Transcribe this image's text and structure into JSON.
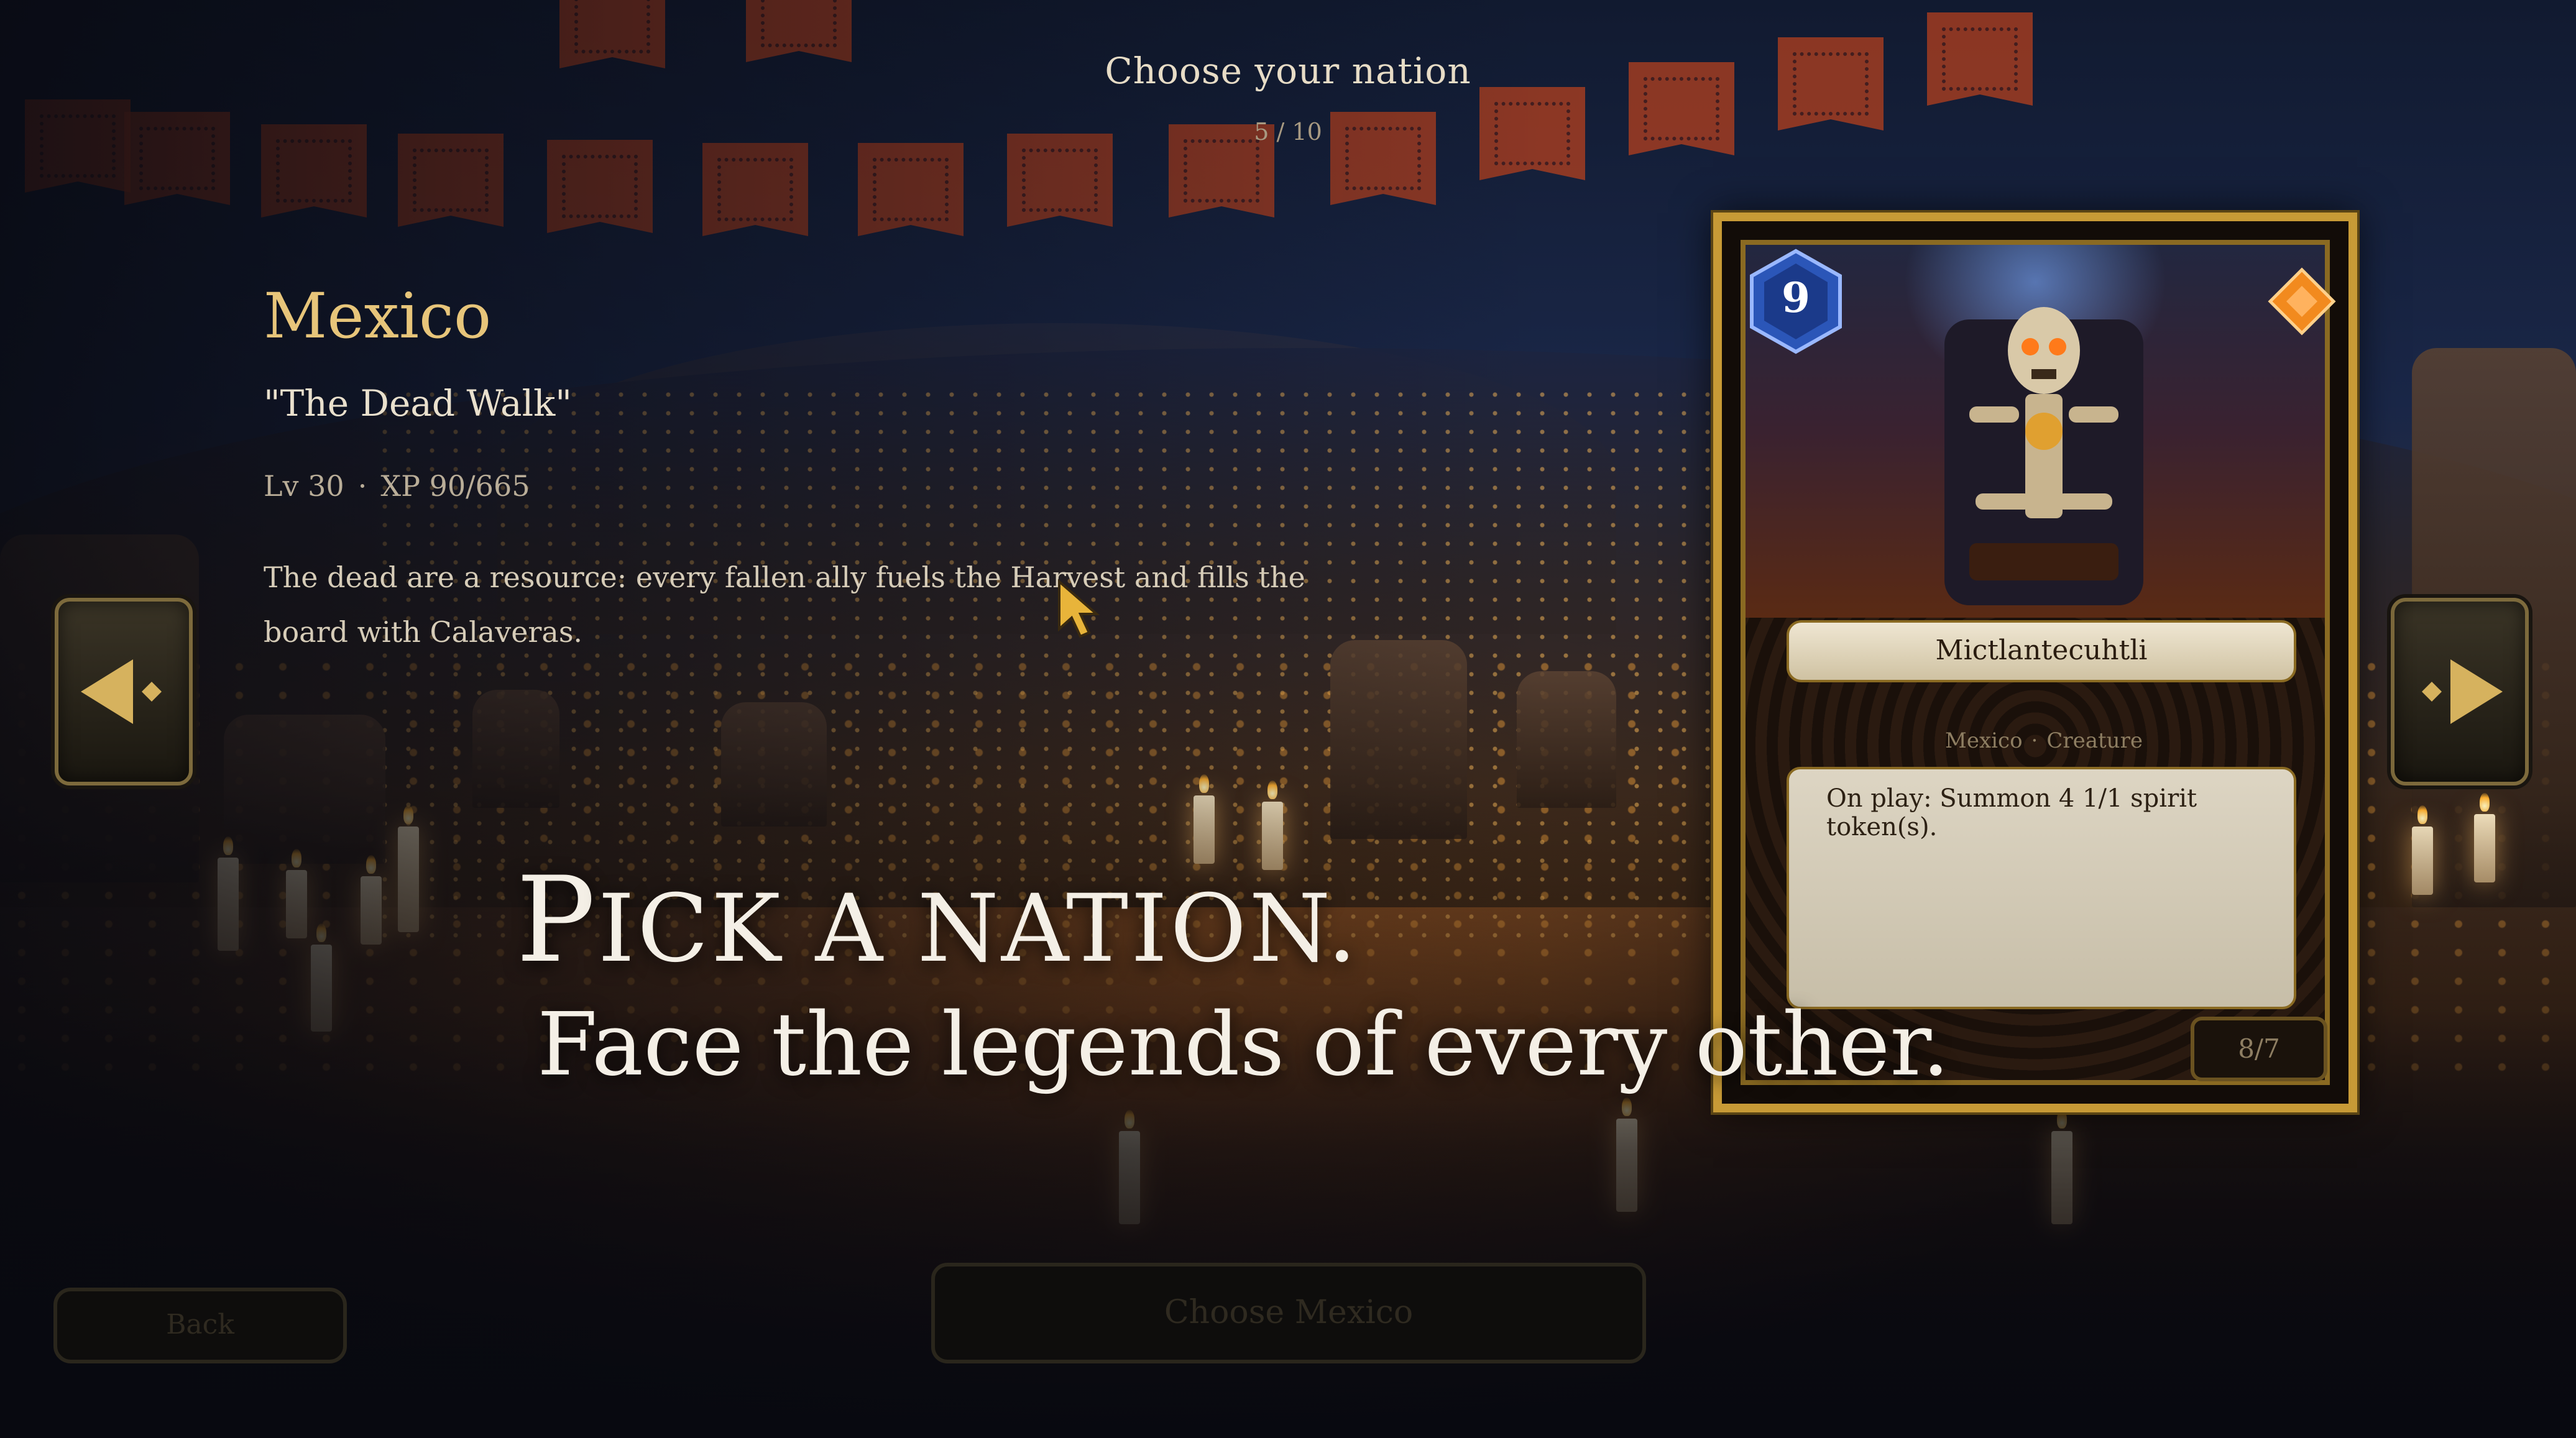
{
  "header": {
    "title": "Choose your nation",
    "counter": "5 / 10"
  },
  "nation": {
    "name": "Mexico",
    "motto": "\"The Dead Walk\"",
    "level": "Lv 30",
    "xp": "XP 90/665",
    "separator": "·",
    "description": "The dead are a resource: every fallen ally fuels the Harvest and fills the board with Calaveras."
  },
  "card": {
    "mana_cost": "9",
    "name": "Mictlantecuhtli",
    "nation": "Mexico",
    "type": "Creature",
    "separator": "·",
    "text": "On play: Summon 4 1/1 spirit token(s).",
    "stats": "8/7"
  },
  "tagline": {
    "line1": "Pick a nation.",
    "line2": "Face the legends of every other."
  },
  "buttons": {
    "back": "Back",
    "choose": "Choose Mexico"
  },
  "icons": {
    "prev": "arrow-left-icon",
    "next": "arrow-right-icon",
    "mana": "mana-gem-icon",
    "rarity": "rarity-diamond-icon",
    "cursor": "cursor-icon"
  },
  "colors": {
    "accent_gold": "#c79a36",
    "title_gold": "#e7c57a",
    "mana_blue": "#2b56b8",
    "rarity_orange": "#f28a1e"
  }
}
